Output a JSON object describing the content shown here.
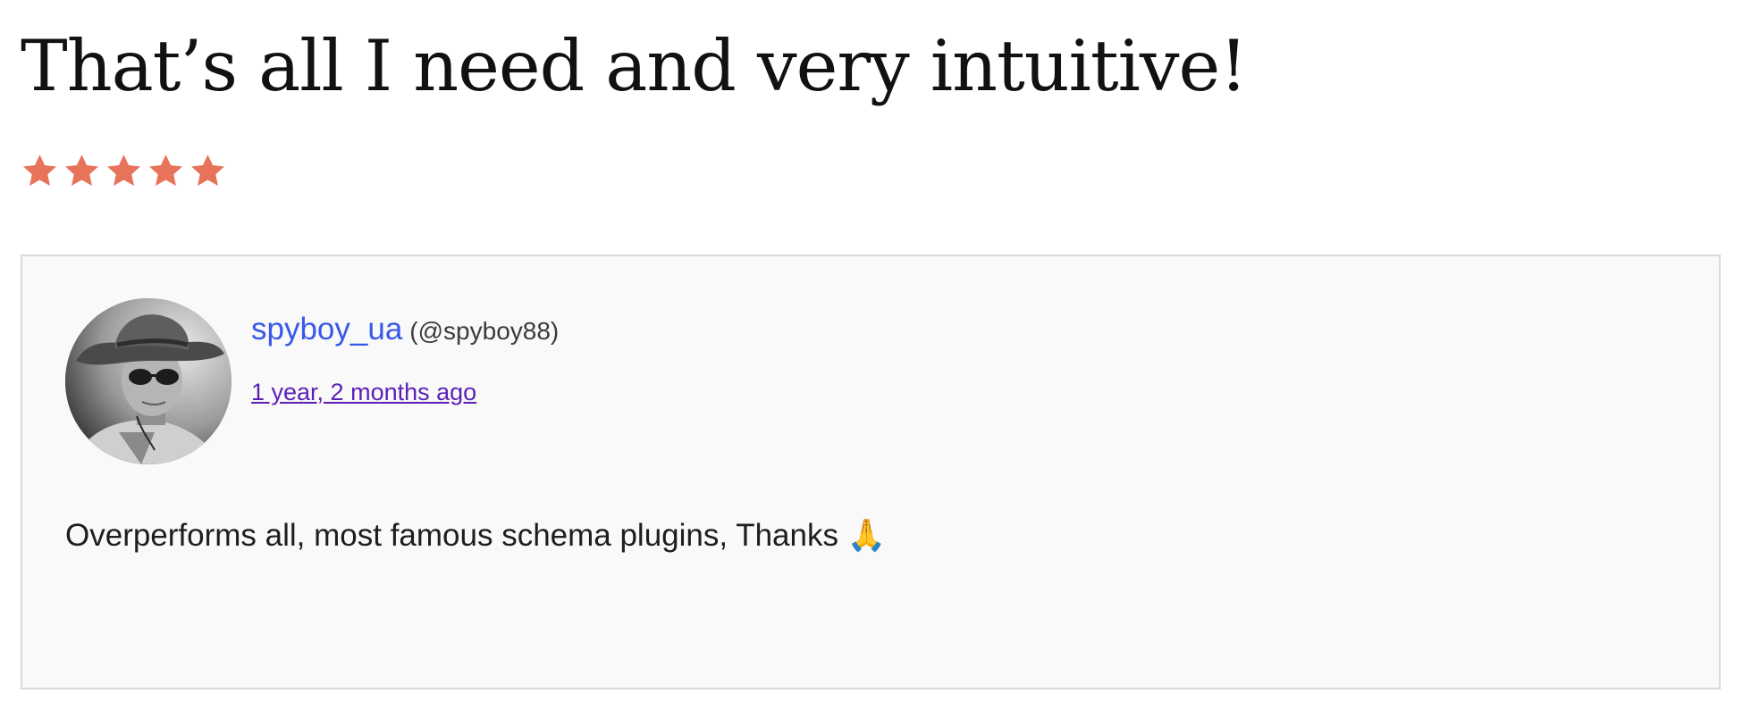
{
  "review": {
    "title": "That’s all I need and very intuitive!",
    "rating": 5,
    "rating_max": 5,
    "star_color": "#e6735a",
    "reviewer": {
      "name": "spyboy_ua",
      "handle": "(@spyboy88)",
      "avatar": "avatar-photo",
      "name_color": "#3858e9"
    },
    "date": "1 year, 2 months ago",
    "body": "Overperforms all, most famous schema plugins, Thanks 🙏"
  }
}
